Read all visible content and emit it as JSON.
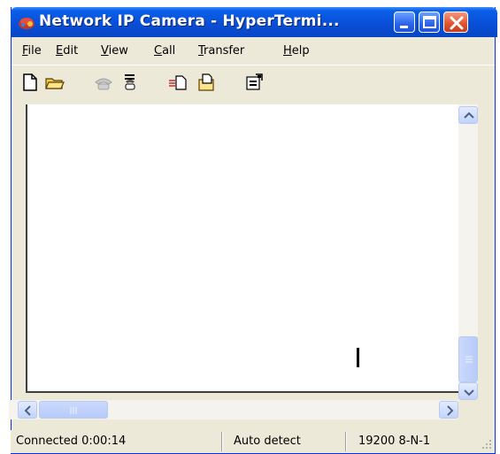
{
  "window": {
    "title": "Network IP Camera - HyperTermi...",
    "icon": "hyperterminal-phone-icon"
  },
  "title_buttons": {
    "minimize_icon": "minimize-icon",
    "maximize_icon": "maximize-icon",
    "close_icon": "close-icon"
  },
  "menu": {
    "items": [
      {
        "label": "File"
      },
      {
        "label": "Edit"
      },
      {
        "label": "View"
      },
      {
        "label": "Call"
      },
      {
        "label": "Transfer"
      },
      {
        "label": "Help"
      }
    ]
  },
  "toolbar": {
    "tools": [
      {
        "icon": "new-icon"
      },
      {
        "icon": "open-icon"
      },
      {
        "icon": "connect-icon"
      },
      {
        "icon": "disconnect-icon"
      },
      {
        "icon": "send-icon"
      },
      {
        "icon": "receive-icon"
      },
      {
        "icon": "properties-icon"
      }
    ]
  },
  "status": {
    "connection": "Connected 0:00:14",
    "detect": "Auto detect",
    "settings": "19200 8-N-1"
  },
  "colors": {
    "title_bar": "#0a4fd8",
    "close_button": "#e0532f",
    "chrome": "#ece9d8",
    "terminal_bg": "#ffffff"
  }
}
